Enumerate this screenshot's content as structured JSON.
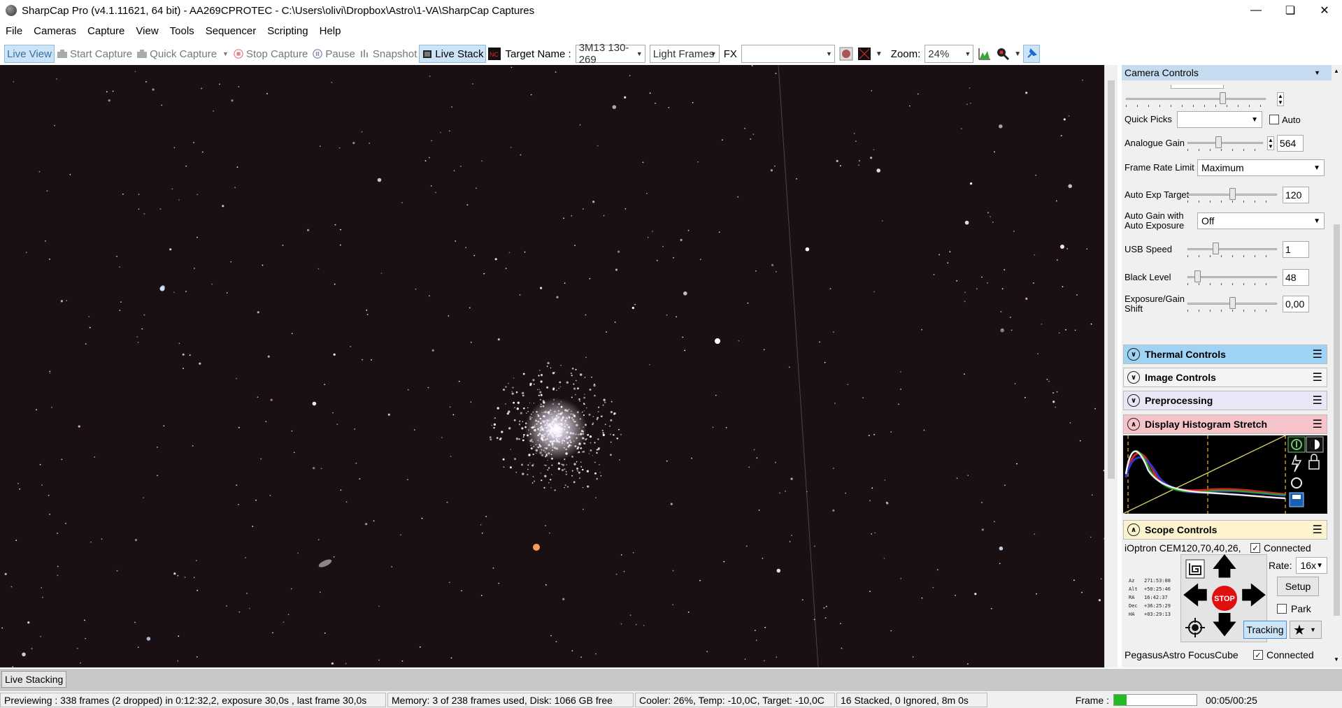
{
  "window": {
    "title": "SharpCap Pro (v4.1.11621, 64 bit) - AA269CPROTEC - C:\\Users\\olivi\\Dropbox\\Astro\\1-VA\\SharpCap Captures"
  },
  "menu": [
    "File",
    "Cameras",
    "Capture",
    "View",
    "Tools",
    "Sequencer",
    "Scripting",
    "Help"
  ],
  "toolbar": {
    "live_view": "Live View",
    "start_capture": "Start Capture",
    "quick_capture": "Quick Capture",
    "stop_capture": "Stop Capture",
    "pause": "Pause",
    "snapshot": "Snapshot",
    "live_stack": "Live Stack",
    "target_label": "Target Name :",
    "target_value": "3M13 130-269",
    "frame_type": "Light Frames",
    "fx_label": "FX",
    "fx_value": "",
    "zoom_label": "Zoom:",
    "zoom_value": "24%"
  },
  "panel": {
    "title": "Camera Controls",
    "quick_picks_label": "Quick Picks",
    "auto_label": "Auto",
    "controls": [
      {
        "label": "Analogue Gain",
        "value": "564",
        "level": 0.4
      },
      {
        "label": "Auto Exp Target",
        "value": "120",
        "level": 0.5
      },
      {
        "label": "USB Speed",
        "value": "1",
        "level": 0.3
      },
      {
        "label": "Black Level",
        "value": "48",
        "level": 0.08
      },
      {
        "label": "Exposure/Gain Shift",
        "value": "0,00",
        "level": 0.5
      }
    ],
    "frame_rate_label": "Frame Rate Limit",
    "frame_rate_value": "Maximum",
    "auto_gain_label": "Auto Gain with Auto Exposure",
    "auto_gain_value": "Off",
    "sections": {
      "thermal": "Thermal Controls",
      "image": "Image Controls",
      "preprocessing": "Preprocessing",
      "histogram": "Display Histogram Stretch",
      "scope": "Scope Controls"
    },
    "scope": {
      "mount": "iOptron CEM120,70,40,26,",
      "connected": "Connected",
      "rate_label": "Rate:",
      "rate_value": "16x",
      "setup": "Setup",
      "park": "Park",
      "tracking": "Tracking",
      "stop": "STOP",
      "coords": [
        [
          "Az",
          "271:53:08"
        ],
        [
          "Alt",
          "+50:25:46"
        ],
        [
          "RA",
          "16:42:37"
        ],
        [
          "Dec",
          "+36:25:29"
        ],
        [
          "HA",
          "+03:29:13"
        ]
      ]
    },
    "focuser": {
      "name": "PegasusAstro FocusCube",
      "connected": "Connected"
    }
  },
  "livestack_tab": "Live Stacking",
  "status": {
    "preview": "Previewing : 338 frames (2 dropped) in 0:12:32,2, exposure 30,0s , last frame 30,0s",
    "memory": "Memory: 3 of 238 frames used, Disk: 1066 GB free",
    "cooler": "Cooler: 26%, Temp: -10,0C, Target: -10,0C",
    "stacked": "16 Stacked, 0 Ignored, 8m 0s",
    "frame_label": "Frame :",
    "timer": "00:05/00:25"
  },
  "colors": {
    "thermal": "#9fd3f5",
    "image": "#f4f4f4",
    "preprocessing": "#e9e6f7",
    "histogram": "#f6c3c8",
    "scope": "#fdf4cd",
    "frame_progress": "#22bb22"
  }
}
